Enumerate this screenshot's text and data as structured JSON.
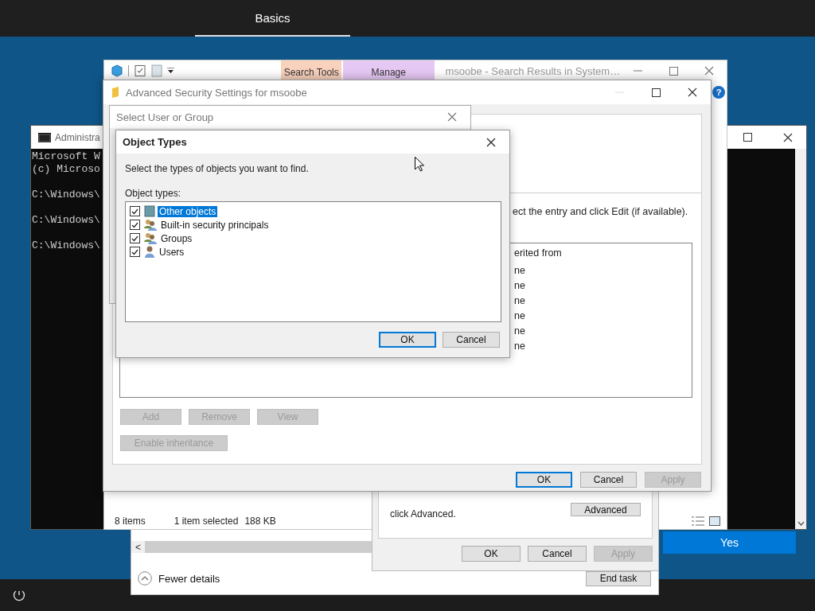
{
  "top_bar": {
    "tabs": [
      {
        "label": "Basics",
        "selected": true
      }
    ]
  },
  "command_window": {
    "title": "Administra",
    "lines": [
      {
        "text": "Microsoft W",
        "kind": "banner"
      },
      {
        "text": "(c) Microso",
        "kind": "banner"
      },
      {
        "text": "C:\\Windows\\",
        "kind": "prompt"
      },
      {
        "text": "C:\\Windows\\",
        "kind": "prompt"
      },
      {
        "text": "C:\\Windows\\",
        "kind": "prompt"
      }
    ]
  },
  "yes_button": {
    "label": "Yes"
  },
  "task_manager": {
    "scroll_arrow": "<",
    "details_toggle": "Fewer details",
    "end_task": "End task"
  },
  "explorer": {
    "help_label": "?",
    "title": "msoobe - Search Results in System…",
    "ribbon_tabs": [
      {
        "label": "Search Tools",
        "color": "#f9d2bd"
      },
      {
        "label": "Manage",
        "color": "#e6c8f4"
      }
    ],
    "status_items": [
      "8 items",
      "1 item selected",
      "188 KB"
    ]
  },
  "properties_dialog": {
    "note": "click Advanced.",
    "advanced_button": "Advanced",
    "buttons": [
      {
        "label": "OK",
        "disabled": false
      },
      {
        "label": "Cancel",
        "disabled": false
      },
      {
        "label": "Apply",
        "disabled": true
      }
    ]
  },
  "advanced_security": {
    "title": "Advanced Security Settings for msoobe",
    "instruction": "ect the entry and click Edit (if available).",
    "list_header": "erited from",
    "list_rows": [
      "ne",
      "ne",
      "ne",
      "ne",
      "ne",
      "ne"
    ],
    "entry_buttons": [
      {
        "label": "Add",
        "disabled": true
      },
      {
        "label": "Remove",
        "disabled": true
      },
      {
        "label": "View",
        "disabled": true
      }
    ],
    "inheritance_button": {
      "label": "Enable inheritance",
      "disabled": true
    },
    "buttons": [
      {
        "label": "OK",
        "disabled": false,
        "default": true
      },
      {
        "label": "Cancel",
        "disabled": false,
        "default": false
      },
      {
        "label": "Apply",
        "disabled": true,
        "default": false
      }
    ]
  },
  "select_user_dialog": {
    "title": "Select User or Group"
  },
  "object_types_dialog": {
    "title": "Object Types",
    "instruction": "Select the types of objects you want to find.",
    "list_label": "Object types:",
    "items": [
      {
        "label": "Other objects",
        "kind": "other",
        "checked": true,
        "selected": true
      },
      {
        "label": "Built-in security principals",
        "kind": "group",
        "checked": true,
        "selected": false
      },
      {
        "label": "Groups",
        "kind": "group",
        "checked": true,
        "selected": false
      },
      {
        "label": "Users",
        "kind": "user",
        "checked": true,
        "selected": false
      }
    ],
    "buttons": [
      {
        "label": "OK",
        "default": true
      },
      {
        "label": "Cancel",
        "default": false
      }
    ]
  }
}
